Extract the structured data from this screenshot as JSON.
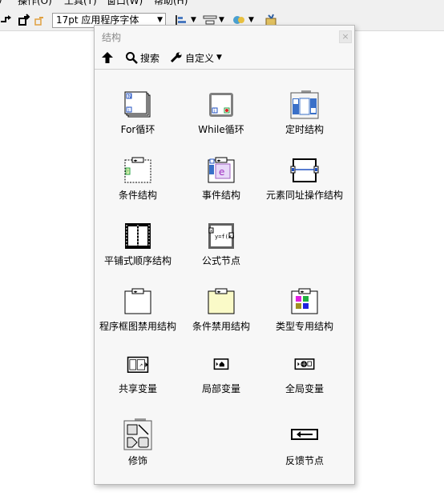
{
  "menubar": {
    "items": [
      "操作(O)",
      "工具(T)",
      "窗口(W)",
      "帮助(H)"
    ]
  },
  "toolbar": {
    "font_select_value": "17pt 应用程序字体"
  },
  "palette": {
    "title": "结构",
    "close_label": "×",
    "toolbar": {
      "up_label": "",
      "search_label": "搜索",
      "customize_label": "自定义"
    },
    "items": [
      {
        "label": "For循环",
        "icon": "for-loop-icon"
      },
      {
        "label": "While循环",
        "icon": "while-loop-icon"
      },
      {
        "label": "定时结构",
        "icon": "timed-structure-icon"
      },
      {
        "label": "条件结构",
        "icon": "case-structure-icon"
      },
      {
        "label": "事件结构",
        "icon": "event-structure-icon"
      },
      {
        "label": "元素同址操作结构",
        "icon": "in-place-element-icon"
      },
      {
        "label": "平铺式顺序结构",
        "icon": "flat-sequence-icon"
      },
      {
        "label": "公式节点",
        "icon": "formula-node-icon"
      },
      {
        "label": "程序框图禁用结构",
        "icon": "diagram-disable-icon"
      },
      {
        "label": "条件禁用结构",
        "icon": "conditional-disable-icon"
      },
      {
        "label": "类型专用结构",
        "icon": "type-specialization-icon"
      },
      {
        "label": "共享变量",
        "icon": "shared-variable-icon"
      },
      {
        "label": "局部变量",
        "icon": "local-variable-icon"
      },
      {
        "label": "全局变量",
        "icon": "global-variable-icon"
      },
      {
        "label": "修饰",
        "icon": "decorations-icon"
      },
      {
        "label": "反馈节点",
        "icon": "feedback-node-icon"
      }
    ]
  }
}
